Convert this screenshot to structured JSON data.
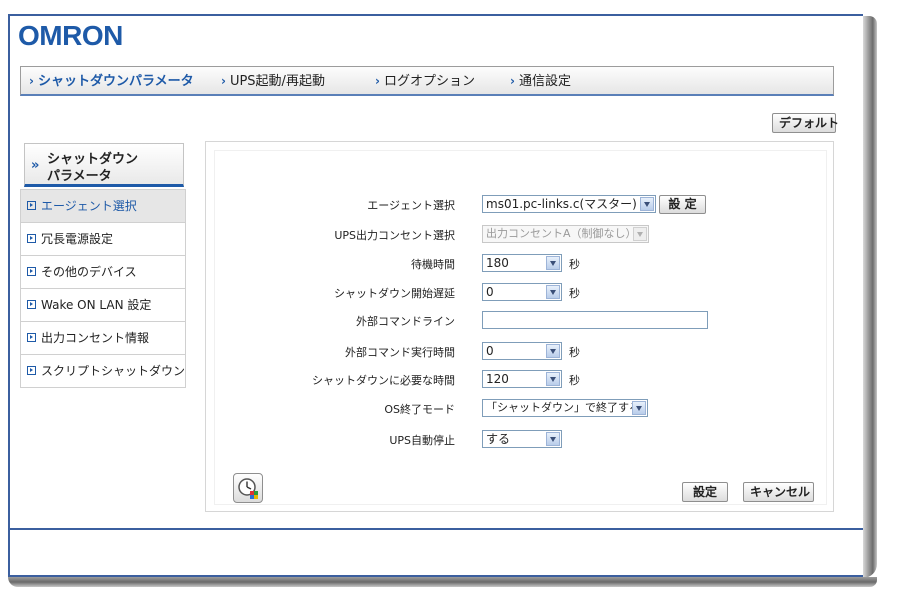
{
  "brand": {
    "logo": "OMRON"
  },
  "tabs": [
    {
      "label": "シャットダウンパラメータ",
      "active": true
    },
    {
      "label": "UPS起動/再起動",
      "active": false
    },
    {
      "label": "ログオプション",
      "active": false
    },
    {
      "label": "通信設定",
      "active": false
    }
  ],
  "toolbar": {
    "default_label": "デフォルト"
  },
  "sidebar": {
    "title_line1": "シャットダウン",
    "title_line2": "パラメータ",
    "items": [
      {
        "label": "エージェント選択",
        "active": true
      },
      {
        "label": "冗長電源設定",
        "active": false
      },
      {
        "label": "その他のデバイス",
        "active": false
      },
      {
        "label": "Wake ON LAN 設定",
        "active": false
      },
      {
        "label": "出力コンセント情報",
        "active": false
      },
      {
        "label": "スクリプトシャットダウン",
        "active": false
      }
    ]
  },
  "form": {
    "agent_label": "エージェント選択",
    "agent_value": "ms01.pc-links.c(マスター)",
    "agent_set_button": "設 定",
    "outlet_label": "UPS出力コンセント選択",
    "outlet_value": "出力コンセントA（制御なし）",
    "wait_label": "待機時間",
    "wait_value": "180",
    "wait_unit": "秒",
    "delay_label": "シャットダウン開始遅延",
    "delay_value": "0",
    "delay_unit": "秒",
    "ext_cmd_label": "外部コマンドライン",
    "ext_cmd_value": "",
    "ext_time_label": "外部コマンド実行時間",
    "ext_time_value": "0",
    "ext_time_unit": "秒",
    "req_time_label": "シャットダウンに必要な時間",
    "req_time_value": "120",
    "req_time_unit": "秒",
    "os_mode_label": "OS終了モード",
    "os_mode_value": "「シャットダウン」で終了する",
    "ups_stop_label": "UPS自動停止",
    "ups_stop_value": "する"
  },
  "footer": {
    "set_button": "設定",
    "cancel_button": "キャンセル"
  },
  "colors": {
    "brand": "#1e5aa8",
    "border": "#3b5f9f"
  }
}
